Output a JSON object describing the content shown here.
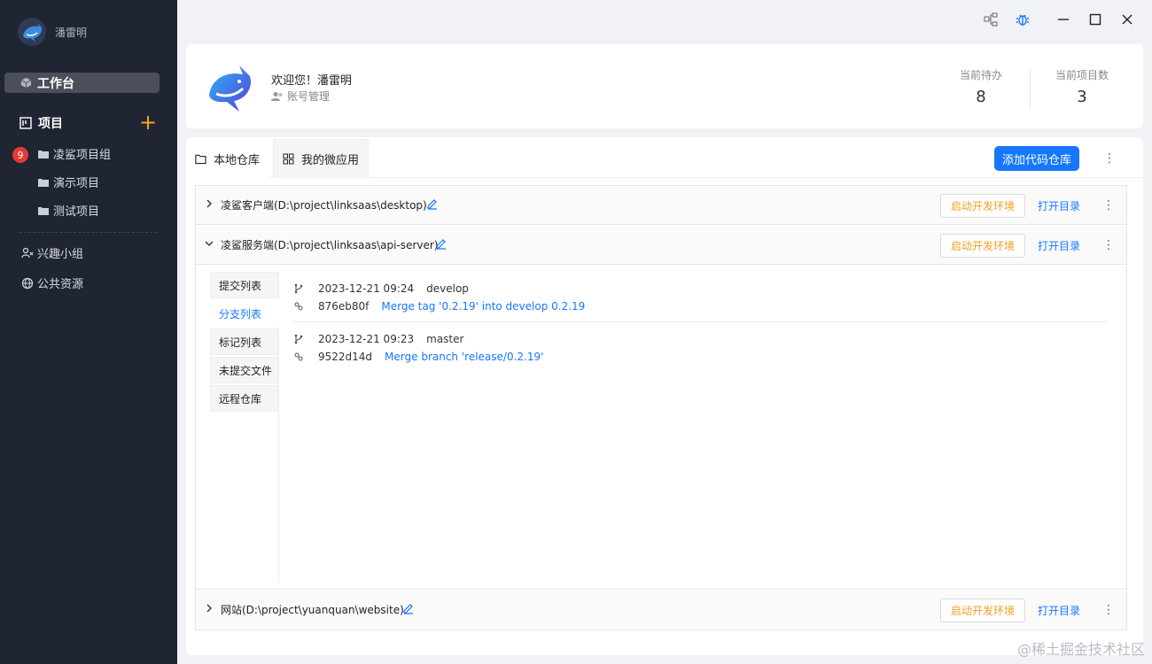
{
  "user": {
    "name": "潘雷明"
  },
  "sidebar": {
    "workbench": "工作台",
    "projects": "项目",
    "add_icon": "plus-icon",
    "group": {
      "name": "凌鲨项目组",
      "badge": "9"
    },
    "children": [
      "演示项目",
      "测试项目"
    ],
    "interest": "兴趣小组",
    "public": "公共资源"
  },
  "header": {
    "welcome": "欢迎您！潘雷明",
    "account": "账号管理",
    "stats": [
      {
        "label": "当前待办",
        "value": "8"
      },
      {
        "label": "当前项目数",
        "value": "3"
      }
    ]
  },
  "tabs": [
    {
      "label": "本地仓库",
      "icon": "folder-icon"
    },
    {
      "label": "我的微应用",
      "icon": "apps-icon"
    }
  ],
  "add_repo": "添加代码仓库",
  "repos": [
    {
      "title": "凌鲨客户端(D:\\project\\linksaas\\desktop)",
      "start": "启动开发环境",
      "open": "打开目录",
      "expanded": false
    },
    {
      "title": "凌鲨服务端(D:\\project\\linksaas\\api-server)",
      "start": "启动开发环境",
      "open": "打开目录",
      "expanded": true
    },
    {
      "title": "网站(D:\\project\\yuanquan\\website)",
      "start": "启动开发环境",
      "open": "打开目录",
      "expanded": false
    }
  ],
  "subtabs": [
    "提交列表",
    "分支列表",
    "标记列表",
    "未提交文件",
    "远程仓库"
  ],
  "active_subtab": "分支列表",
  "branches": [
    {
      "time": "2023-12-21 09:24",
      "branch": "develop",
      "hash": "876eb80f",
      "message": "Merge tag '0.2.19' into develop 0.2.19"
    },
    {
      "time": "2023-12-21 09:23",
      "branch": "master",
      "hash": "9522d14d",
      "message": "Merge branch 'release/0.2.19'"
    }
  ],
  "watermark": "@稀土掘金技术社区",
  "colors": {
    "sidebar": "#1f2532",
    "primary": "#1677ff",
    "accent": "#f5a623",
    "badge": "#e53935"
  }
}
